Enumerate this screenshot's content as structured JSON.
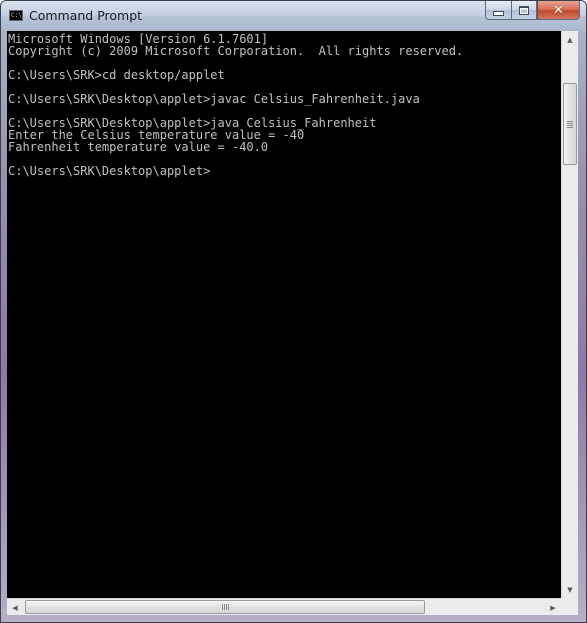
{
  "window": {
    "title": "Command Prompt",
    "icon_text": "C:\\_",
    "minimize_icon": "minimize-icon",
    "maximize_icon": "maximize-icon",
    "close_icon": "close-icon",
    "close_glyph": "✕"
  },
  "console": {
    "text_color": "#c0c0c0",
    "background": "#000000",
    "lines": [
      "Microsoft Windows [Version 6.1.7601]",
      "Copyright (c) 2009 Microsoft Corporation.  All rights reserved.",
      "",
      "C:\\Users\\SRK>cd desktop/applet",
      "",
      "C:\\Users\\SRK\\Desktop\\applet>javac Celsius_Fahrenheit.java",
      "",
      "C:\\Users\\SRK\\Desktop\\applet>java Celsius_Fahrenheit",
      "Enter the Celsius temperature value = -40",
      "Fahrenheit temperature value = -40.0",
      "",
      "C:\\Users\\SRK\\Desktop\\applet>"
    ]
  },
  "scrollbars": {
    "up_arrow": "▲",
    "down_arrow": "▼",
    "left_arrow": "◀",
    "right_arrow": "▶"
  }
}
